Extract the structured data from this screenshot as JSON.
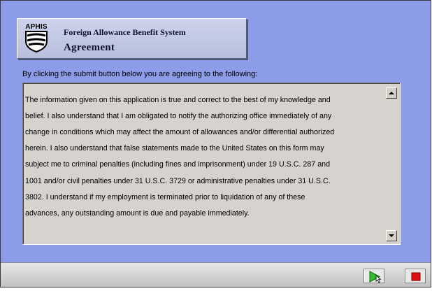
{
  "header": {
    "logo_text": "APHIS",
    "app_title": "Foreign Allowance Benefit System",
    "page_title": "Agreement"
  },
  "intro_text": "By clicking the submit button below you are agreeing to the following:",
  "agreement": {
    "lines": [
      "The information given on this application is true and correct to the best of my knowledge and",
      "belief. I also understand that I am obligated to notify the authorizing office immediately of any",
      "change in conditions which may affect the amount of allowances and/or differential authorized",
      "herein. I also understand that false statements made to the United States on this form may",
      "subject me to criminal penalties (including fines and imprisonment)  under 19 U.S.C. 287 and",
      "1001 and/or civil penalties  under 31 U.S.C. 3729 or administrative penalties under 31 U.S.C.",
      "3802.    I understand if my employment is terminated prior to liquidation of any of these",
      "advances,  any outstanding amount is due and payable immediately."
    ]
  },
  "toolbar": {
    "submit_icon": "play-arrow-icon",
    "stop_icon": "stop-square-icon",
    "colors": {
      "submit_green": "#2fbf2f",
      "stop_red": "#e01010"
    }
  }
}
